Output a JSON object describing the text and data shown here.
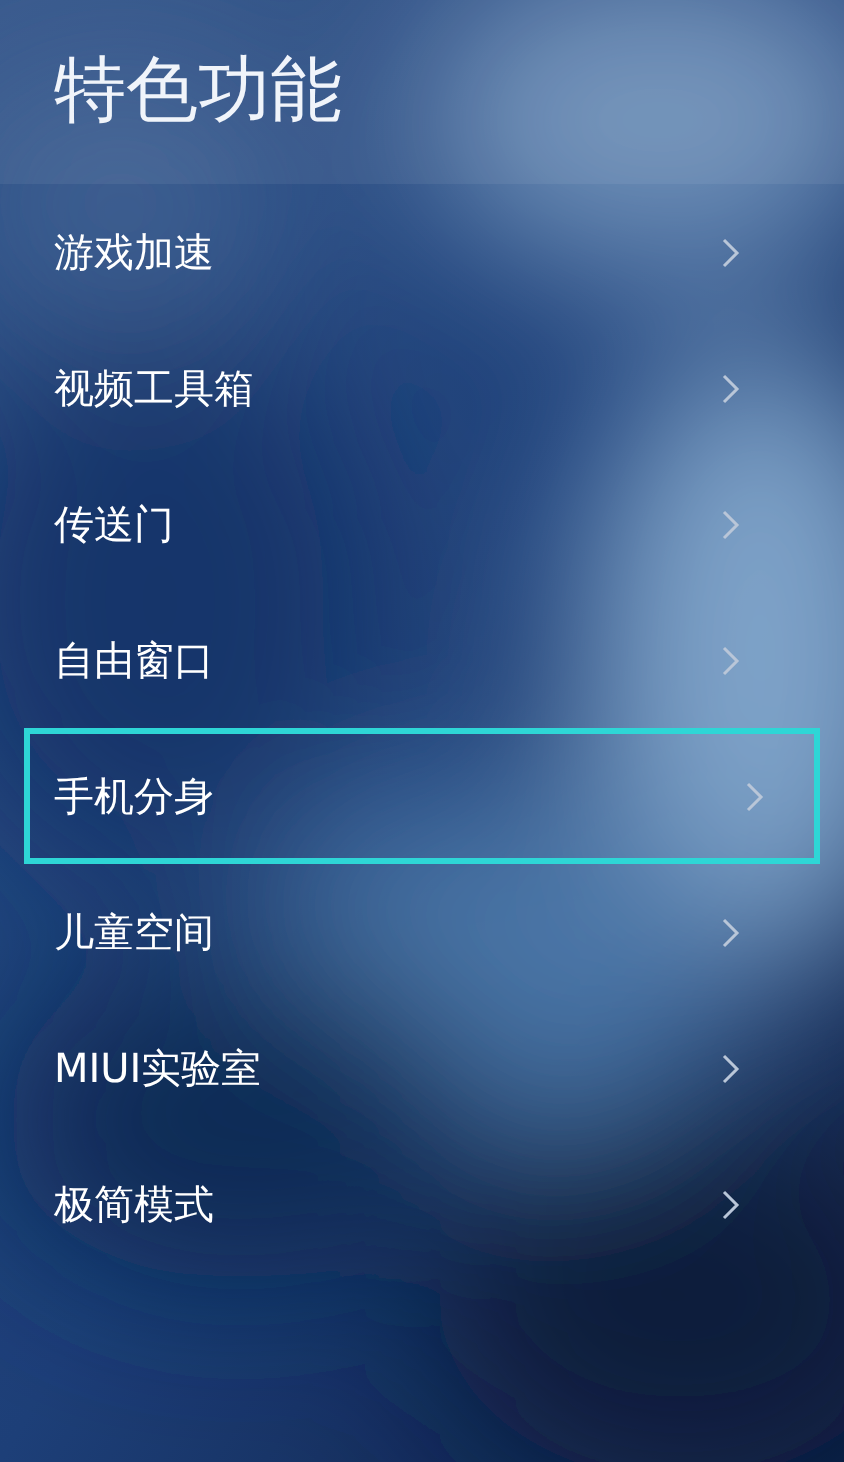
{
  "title": "特色功能",
  "items": [
    {
      "label": "游戏加速",
      "highlighted": false
    },
    {
      "label": "视频工具箱",
      "highlighted": false
    },
    {
      "label": "传送门",
      "highlighted": false
    },
    {
      "label": "自由窗口",
      "highlighted": false
    },
    {
      "label": "手机分身",
      "highlighted": true
    },
    {
      "label": "儿童空间",
      "highlighted": false
    },
    {
      "label": "MIUI实验室",
      "highlighted": false
    },
    {
      "label": "极简模式",
      "highlighted": false
    }
  ]
}
